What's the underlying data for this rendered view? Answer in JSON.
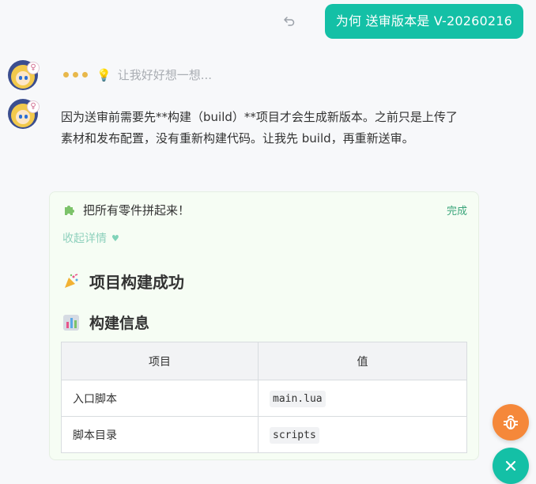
{
  "user_message": {
    "text": "为何 送审版本是 V-20260216"
  },
  "assistant": {
    "thinking_text": "让我好好想一想...",
    "reply_text": "因为送审前需要先**构建（build）**项目才会生成新版本。之前只是上传了素材和发布配置，没有重新构建代码。让我先 build，再重新送审。"
  },
  "tool_card": {
    "title": "把所有零件拼起来！",
    "status": "完成",
    "collapse_label": "收起详情",
    "heading1": "项目构建成功",
    "heading2": "构建信息",
    "table": {
      "headers": [
        "项目",
        "值"
      ],
      "rows": [
        {
          "key": "入口脚本",
          "value": "main.lua"
        },
        {
          "key": "脚本目录",
          "value": "scripts"
        }
      ]
    }
  },
  "colors": {
    "accent": "#14c0a6",
    "bug_button": "#f5883a",
    "status_green": "#3aa57a"
  },
  "icons": [
    "undo-icon",
    "lightbulb-icon",
    "puzzle-icon",
    "party-popper-icon",
    "bar-chart-icon",
    "bug-icon",
    "close-icon"
  ]
}
